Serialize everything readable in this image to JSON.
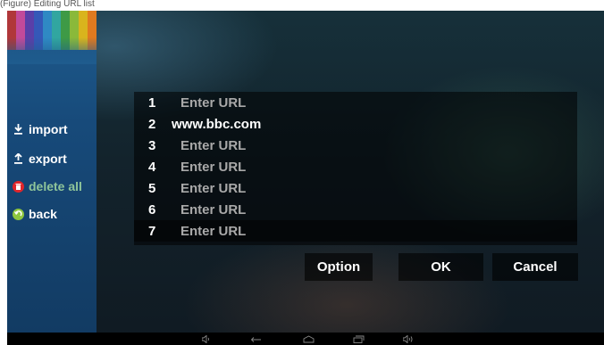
{
  "page_caption": "(Figure) Editing URL list",
  "sidebar": {
    "stripe_colors": [
      "#b0373a",
      "#c24a9a",
      "#5a3fa8",
      "#3558b8",
      "#2f89c4",
      "#31a6a0",
      "#3e9a46",
      "#8ab93a",
      "#d9b41d",
      "#e07a1f"
    ],
    "items": [
      {
        "label": "import",
        "icon": "download-icon"
      },
      {
        "label": "export",
        "icon": "upload-icon"
      },
      {
        "label": "delete all",
        "icon": "trash-icon"
      },
      {
        "label": "back",
        "icon": "back-arrow-icon"
      }
    ]
  },
  "url_list": {
    "rows": [
      {
        "num": "1",
        "value": "Enter URL"
      },
      {
        "num": "2",
        "value": "www.bbc.com"
      },
      {
        "num": "3",
        "value": "Enter URL"
      },
      {
        "num": "4",
        "value": "Enter URL"
      },
      {
        "num": "5",
        "value": "Enter URL"
      },
      {
        "num": "6",
        "value": "Enter URL"
      },
      {
        "num": "7",
        "value": "Enter URL"
      }
    ],
    "selected_row": "7"
  },
  "buttons": {
    "option_label": "Option",
    "ok_label": "OK",
    "cancel_label": "Cancel"
  },
  "navbar": {
    "icons": [
      "volume-down-icon",
      "back-icon",
      "home-icon",
      "recents-icon",
      "volume-up-icon"
    ]
  }
}
